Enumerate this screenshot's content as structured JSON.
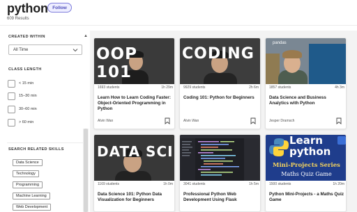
{
  "header": {
    "title": "python",
    "follow_label": "Follow",
    "results": "609 Results"
  },
  "sidebar": {
    "created_within": {
      "title": "CREATED WITHIN",
      "selected": "All Time"
    },
    "class_length": {
      "title": "CLASS LENGTH",
      "options": [
        "< 15 min",
        "15–30 min",
        "30–60 min",
        "> 60 min"
      ]
    },
    "skills": {
      "title": "SEARCH RELATED SKILLS",
      "items": [
        "Data Science",
        "Technology",
        "Programming",
        "Machine Learning",
        "Web Development"
      ]
    }
  },
  "cards": [
    {
      "students": "1693 students",
      "duration": "1h 29m",
      "title": "Learn How to Learn Coding Faster: Object-Oriented Programming in Python",
      "author": "Alvin Wan",
      "thumb_text": "OOP 101"
    },
    {
      "students": "9929 students",
      "duration": "2h 6m",
      "title": "Coding 101: Python for Beginners",
      "author": "Alvin Wan",
      "thumb_text": "CODING"
    },
    {
      "students": "1857 students",
      "duration": "4h 3m",
      "title": "Data Science and Business Analytics with Python",
      "author": "Jesper Dramsch",
      "thumb_text": "pandas"
    },
    {
      "students": "1169 students",
      "duration": "1h 0m",
      "title": "Data Science 101: Python Data Visualization for Beginners",
      "author": "",
      "thumb_text": "DATA SCI"
    },
    {
      "students": "3041 students",
      "duration": "1h 5m",
      "title": "Professional Python Web Development Using Flask",
      "author": "",
      "thumb_text": ""
    },
    {
      "students": "1500 students",
      "duration": "1h 20m",
      "title": "Python Mini-Projects - a Maths Quiz Game",
      "author": "",
      "thumb_text": "Learn python",
      "thumb_sub": "Mini-Projects Series",
      "thumb_sub2": "Maths Quiz Game"
    }
  ],
  "colors": {
    "accent": "#4a49b8",
    "follow_bg": "#eeeeff",
    "thumb_blue": "#1f3d8c"
  }
}
